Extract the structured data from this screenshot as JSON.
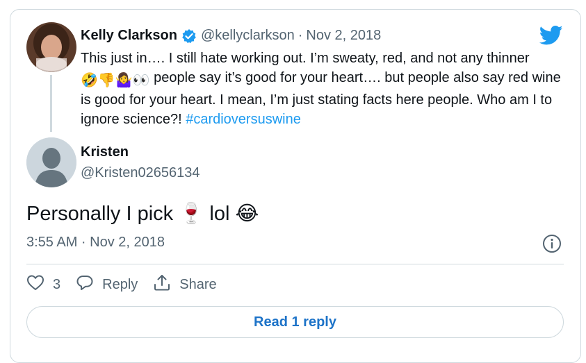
{
  "quoted_tweet": {
    "author_name": "Kelly Clarkson",
    "handle": "@kellyclarkson",
    "separator": "·",
    "date": "Nov 2, 2018",
    "text_part1": "This just in…. I still hate working out. I’m sweaty, red, and not any thinner ",
    "emojis": "🤣👎🤷‍♀️👀",
    "text_part2": " people say it’s good for your heart…. but people also say red wine is good for your heart. I mean, I’m just stating facts here people. Who am I to ignore science?! ",
    "hashtag": "#cardioversuswine"
  },
  "reply": {
    "author_name": "Kristen",
    "handle": "@Kristen02656134",
    "text_before": "Personally I pick ",
    "emoji_wine": "🍷",
    "text_middle": " lol ",
    "emoji_laugh": "😂",
    "timestamp": "3:55 AM · Nov 2, 2018"
  },
  "actions": {
    "like_count": "3",
    "reply_label": "Reply",
    "share_label": "Share"
  },
  "read_replies_label": "Read 1 reply",
  "colors": {
    "accent": "#1d9bf0",
    "link_button_text": "#1d73c8",
    "muted_text": "#536471",
    "border": "#cfd9de"
  },
  "icons": [
    "verified-badge-icon",
    "twitter-bird-icon",
    "info-icon",
    "heart-icon",
    "reply-bubble-icon",
    "share-icon"
  ]
}
